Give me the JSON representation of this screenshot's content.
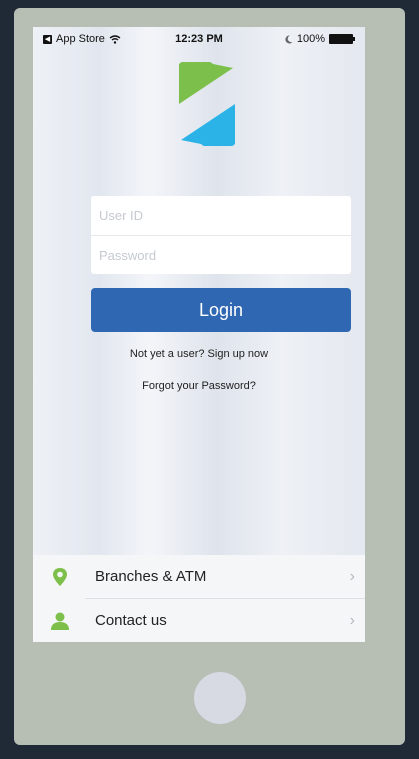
{
  "status_bar": {
    "carrier": "App Store",
    "time": "12:23 PM",
    "battery": "100%"
  },
  "login_form": {
    "user_id_placeholder": "User ID",
    "password_placeholder": "Password",
    "login_label": "Login"
  },
  "links": {
    "signup": "Not yet a user?  Sign up now",
    "forgot": "Forgot your Password?"
  },
  "menu": {
    "items": [
      {
        "label": "Branches & ATM",
        "icon": "location-pin-icon"
      },
      {
        "label": "Contact us",
        "icon": "person-icon"
      }
    ]
  },
  "colors": {
    "brand_blue": "#2f67b2",
    "logo_green": "#7cc04b",
    "logo_cyan": "#2bb3e7",
    "icon_green": "#7cc04b"
  }
}
